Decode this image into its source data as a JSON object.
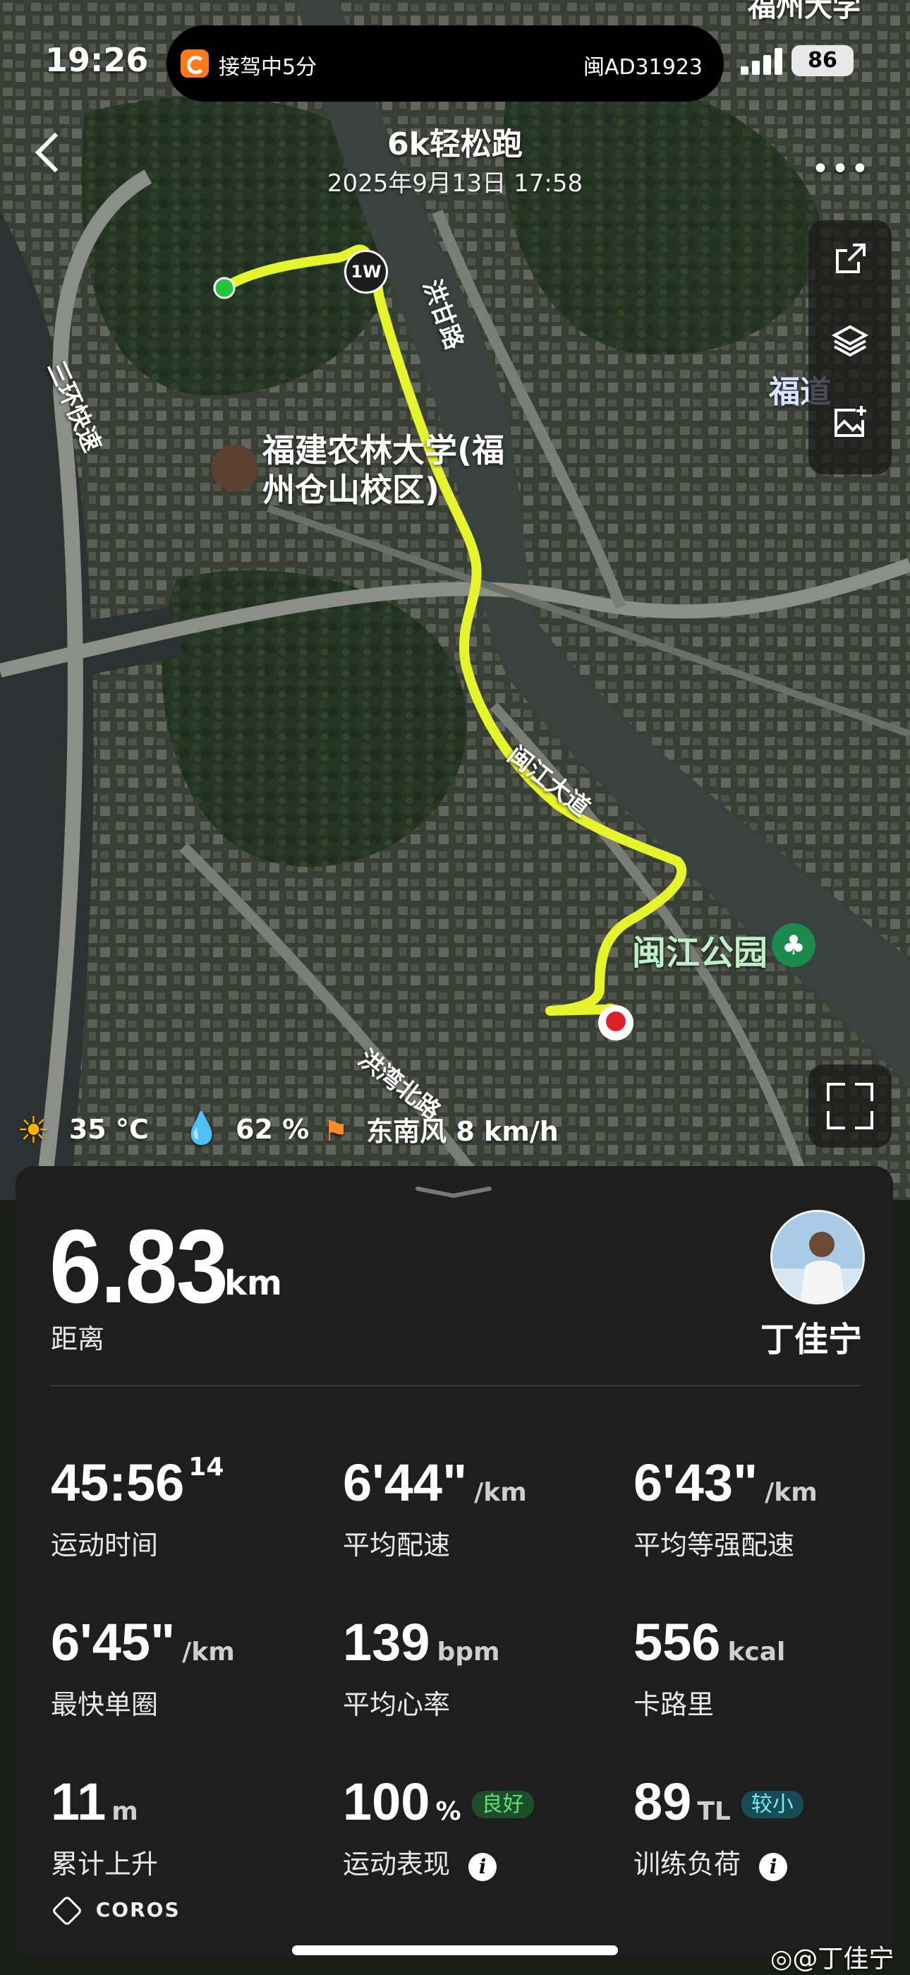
{
  "status_bar": {
    "time": "19:26",
    "island_left": "接驾中5分",
    "island_right": "闽AD31923",
    "battery": "86"
  },
  "header": {
    "title": "6k轻松跑",
    "subtitle": "2025年9月13日 17:58"
  },
  "map": {
    "labels": {
      "uni_line1": "福建农林大学(福",
      "uni_line2": "州仓山校区)",
      "top_right": "福州大学",
      "side_label": "福道",
      "road_hongbai": "洪甘路",
      "road_sanhuan": "三环快速",
      "road_minjiang": "闽江大道",
      "road_hongwan": "洪湾北路",
      "park": "闽江公园",
      "lap_marker": "1W"
    },
    "route_color": "#e6f52b",
    "start_color": "#22c43a",
    "end_color": "#e0202a"
  },
  "weather": {
    "temp": "35 °C",
    "humidity": "62 %",
    "wind": "东南风 8 km/h"
  },
  "summary": {
    "distance": "6.83",
    "distance_unit": "km",
    "distance_label": "距离",
    "user_name": "丁佳宁"
  },
  "stats": [
    {
      "value": "45:56",
      "sup": "14",
      "unit": "",
      "label": "运动时间"
    },
    {
      "value": "6'44\"",
      "sup": "",
      "unit": "/km",
      "label": "平均配速"
    },
    {
      "value": "6'43\"",
      "sup": "",
      "unit": "/km",
      "label": "平均等强配速"
    },
    {
      "value": "6'45\"",
      "sup": "",
      "unit": "/km",
      "label": "最快单圈"
    },
    {
      "value": "139",
      "sup": "",
      "unit": "bpm",
      "label": "平均心率"
    },
    {
      "value": "556",
      "sup": "",
      "unit": "kcal",
      "label": "卡路里"
    },
    {
      "value": "11",
      "sup": "",
      "unit": "m",
      "label": "累计上升"
    },
    {
      "value": "100",
      "sup": "",
      "unit": "%",
      "label": "运动表现",
      "badge": "良好"
    },
    {
      "value": "89",
      "sup": "",
      "unit": "TL",
      "label": "训练负荷",
      "badge": "较小"
    }
  ],
  "footer": {
    "brand": "COROS",
    "watermark": "@丁佳宁"
  }
}
